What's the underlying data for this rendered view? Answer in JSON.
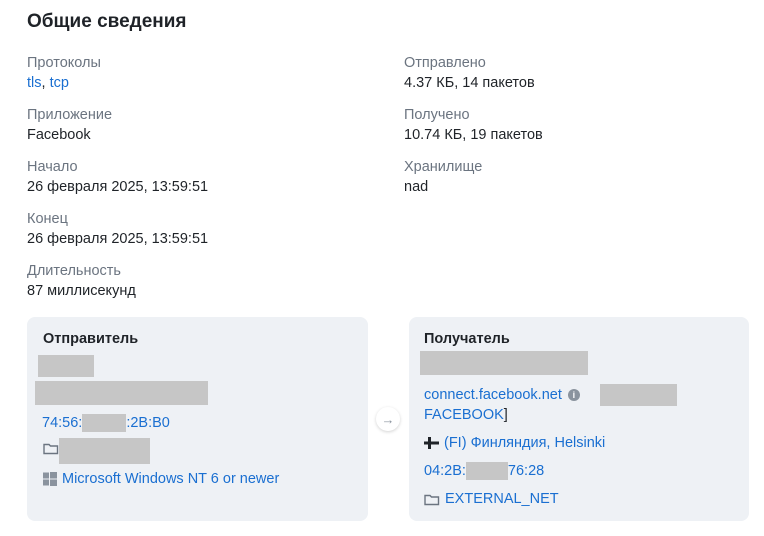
{
  "section_title": "Общие сведения",
  "fields_left": [
    {
      "label": "Протоколы",
      "value_parts": [
        "tls",
        ", ",
        "tcp"
      ]
    },
    {
      "label": "Приложение",
      "value": "Facebook"
    },
    {
      "label": "Начало",
      "value": "26 февраля 2025, 13:59:51"
    },
    {
      "label": "Конец",
      "value": "26 февраля 2025, 13:59:51"
    },
    {
      "label": "Длительность",
      "value": "87 миллисекунд"
    }
  ],
  "fields_right": [
    {
      "label": "Отправлено",
      "value": "4.37 КБ, 14 пакетов"
    },
    {
      "label": "Получено",
      "value": "10.74 КБ, 19 пакетов"
    },
    {
      "label": "Хранилище",
      "value": "nad"
    }
  ],
  "sender": {
    "title": "Отправитель",
    "mac_prefix": "74:56:",
    "mac_suffix": ":2B:B0",
    "os": "Microsoft Windows NT 6 or newer"
  },
  "receiver": {
    "title": "Получатель",
    "host": "connect.facebook.net",
    "org": "FACEBOOK",
    "org_bracket": "]",
    "geo": "(FI) Финляндия, Helsinki",
    "mac_prefix": "04:2B:",
    "mac_suffix": "76:28",
    "network": "EXTERNAL_NET"
  },
  "arrow": "→",
  "colors": {
    "link": "#1a6fd1",
    "label": "#6b7480",
    "card_bg": "#eef1f5",
    "redaction": "#c6c6c6"
  }
}
